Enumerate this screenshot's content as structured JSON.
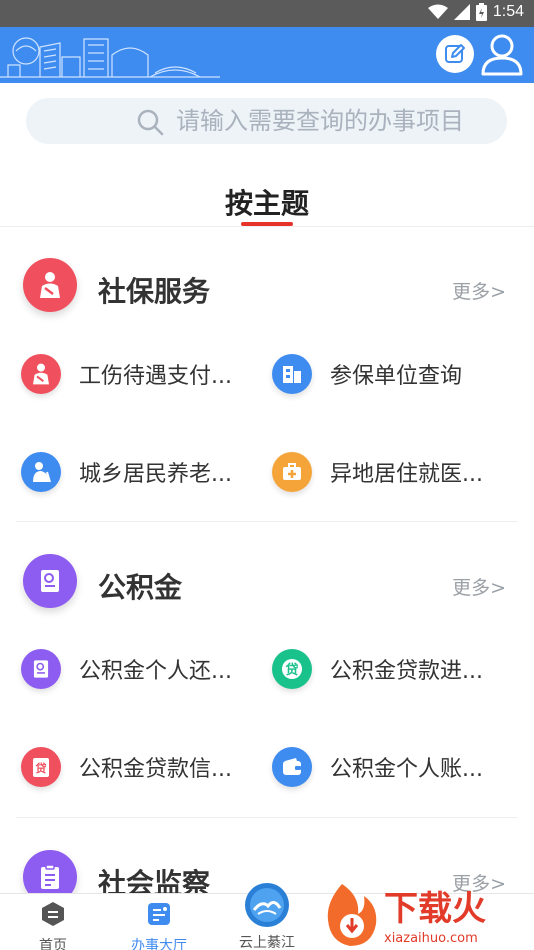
{
  "status_bar": {
    "time": "1:54"
  },
  "search": {
    "placeholder": "请输入需要查询的办事项目"
  },
  "tab": {
    "title": "按主题"
  },
  "sections": [
    {
      "title": "社保服务",
      "more": "更多>",
      "icon": "injured-person-icon",
      "color": "#f0505e",
      "items": [
        {
          "label": "工伤待遇支付...",
          "icon": "injured-person-icon",
          "color": "#f0505e"
        },
        {
          "label": "参保单位查询",
          "icon": "building-icon",
          "color": "#3f8cf0"
        },
        {
          "label": "城乡居民养老...",
          "icon": "elderly-person-icon",
          "color": "#3f8cf0"
        },
        {
          "label": "异地居住就医...",
          "icon": "medical-kit-icon",
          "color": "#f5a43a"
        }
      ]
    },
    {
      "title": "公积金",
      "more": "更多>",
      "icon": "document-icon",
      "color": "#8d5cf0",
      "items": [
        {
          "label": "公积金个人还...",
          "icon": "document-icon",
          "color": "#8d5cf0"
        },
        {
          "label": "公积金贷款进...",
          "icon": "loan-icon",
          "color": "#19c28b"
        },
        {
          "label": "公积金贷款信...",
          "icon": "loan-doc-icon",
          "color": "#f0505e"
        },
        {
          "label": "公积金个人账...",
          "icon": "wallet-icon",
          "color": "#3f8cf0"
        }
      ]
    },
    {
      "title": "社会监察",
      "more": "更多>",
      "icon": "clipboard-icon",
      "color": "#8d5cf0"
    }
  ],
  "bottom_nav": [
    {
      "label": "首页",
      "icon": "home-icon",
      "active": false
    },
    {
      "label": "办事大厅",
      "icon": "service-hall-icon",
      "active": true
    },
    {
      "label": "云上綦江",
      "icon": "cloud-qijiang-logo-icon",
      "active": false
    }
  ],
  "watermark": {
    "brand": "下载火",
    "domain": "xiazaihuo.com"
  },
  "colors": {
    "primary": "#3f8cf0",
    "accent_red": "#e6322b",
    "text": "#333333",
    "muted": "#9aa0a6"
  }
}
